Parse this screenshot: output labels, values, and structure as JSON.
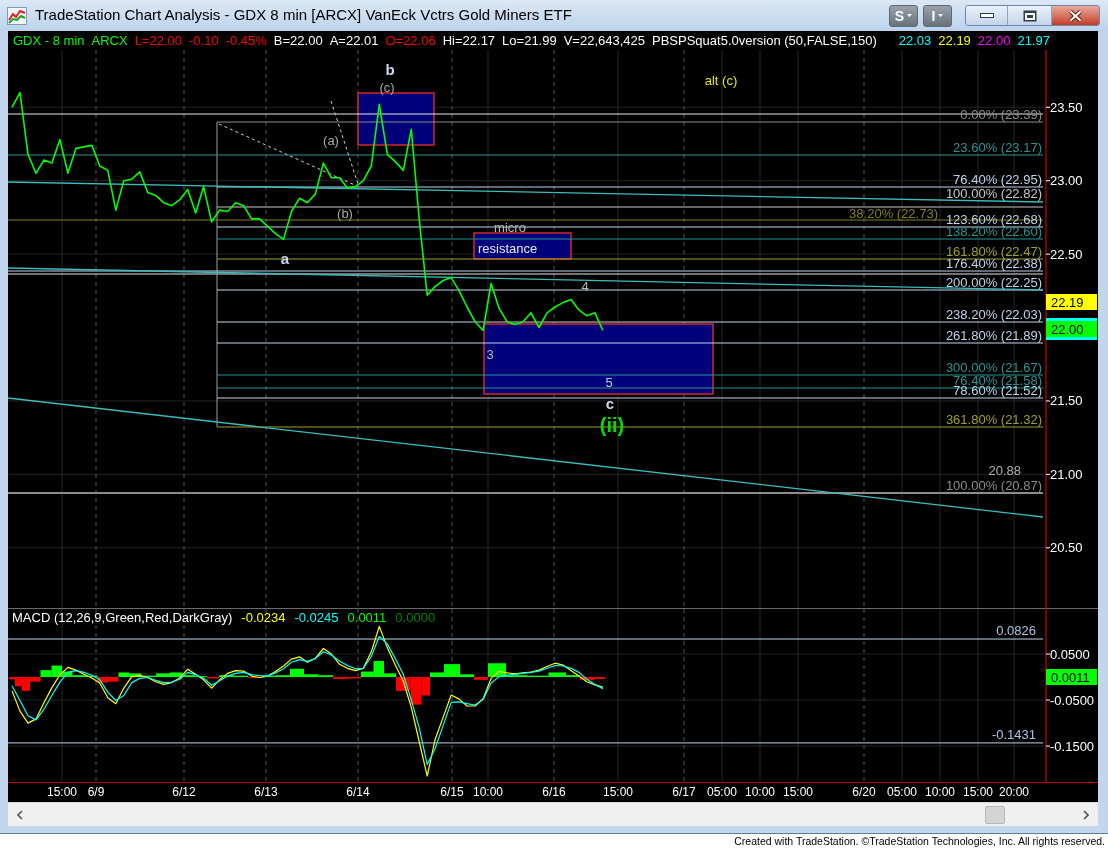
{
  "window": {
    "title": "TradeStation Chart Analysis - GDX 8 min [ARCX] VanEck Vctrs Gold Miners ETF",
    "tool_buttons": [
      {
        "label": "S"
      },
      {
        "label": "I"
      }
    ]
  },
  "quote_bar": {
    "items": [
      {
        "text": "GDX - 8 min",
        "color": "#00ff00"
      },
      {
        "text": "ARCX",
        "color": "#00ff00"
      },
      {
        "text": "L=22.00",
        "color": "#ff0000"
      },
      {
        "text": "-0.10",
        "color": "#ff0000"
      },
      {
        "text": "-0.45%",
        "color": "#ff0000"
      },
      {
        "text": "B=22.00",
        "color": "#ffffff"
      },
      {
        "text": "A=22.01",
        "color": "#ffffff"
      },
      {
        "text": "O=22.06",
        "color": "#ff0000"
      },
      {
        "text": "Hi=22.17",
        "color": "#ffffff"
      },
      {
        "text": "Lo=21.99",
        "color": "#ffffff"
      },
      {
        "text": "V=22,643,425",
        "color": "#ffffff"
      }
    ],
    "study": {
      "label": "PBSPSquat5.0version (50,FALSE,150)",
      "values": [
        {
          "text": "22.03",
          "color": "#00ffff"
        },
        {
          "text": "22.19",
          "color": "#ffff00"
        },
        {
          "text": "22.00",
          "color": "#ff00ff"
        },
        {
          "text": "21.97",
          "color": "#00ffff"
        }
      ]
    }
  },
  "price_chart": {
    "axis_labels": [
      "23.50",
      "23.00",
      "22.50",
      "21.50",
      "21.00",
      "20.50"
    ],
    "price_badges": [
      {
        "text": "22.19",
        "color": "#ffff00"
      },
      {
        "text": "22.00",
        "color": "#00ff00"
      }
    ],
    "fib_levels": [
      {
        "label": "0.00% (23.39)",
        "color": "#8c8c8c"
      },
      {
        "label": "23.60% (23.17)",
        "color": "#2a9494"
      },
      {
        "label": "76.40% (22.95)",
        "color": "#c0d4ec"
      },
      {
        "label": "100.00% (22.82)",
        "color": "#c8c8c8"
      },
      {
        "label": "38.20% (22.73)",
        "color": "#808020"
      },
      {
        "label": "123.60% (22.68)",
        "color": "#c0d4ec"
      },
      {
        "label": "138.20% (22.60)",
        "color": "#2a9494"
      },
      {
        "label": "161.80% (22.47)",
        "color": "#a0a028"
      },
      {
        "label": "176.40% (22.38)",
        "color": "#c0d4ec"
      },
      {
        "label": "200.00% (22.25)",
        "color": "#c0d4ec"
      },
      {
        "label": "238.20% (22.03)",
        "color": "#c0d4ec"
      },
      {
        "label": "261.80% (21.89)",
        "color": "#c0d4ec"
      },
      {
        "label": "300.00% (21.67)",
        "color": "#2a9494"
      },
      {
        "label": "76.40% (21.58)",
        "color": "#2a9494"
      },
      {
        "label": "78.60% (21.52)",
        "color": "#c0d4ec"
      },
      {
        "label": "361.80% (21.32)",
        "color": "#a0a028"
      },
      {
        "label": "100.00% (20.87)",
        "color": "#8c8c8c"
      }
    ],
    "price_marker": "20.88",
    "wave_labels": [
      {
        "text": "b",
        "kind": "major",
        "color": "#c8d8f0"
      },
      {
        "text": "(c)",
        "kind": "minor",
        "color": "#a8a8a8"
      },
      {
        "text": "alt (c)",
        "kind": "minor",
        "color": "#e8e800"
      },
      {
        "text": "(a)",
        "kind": "minor",
        "color": "#a8a8a8"
      },
      {
        "text": "(b)",
        "kind": "minor",
        "color": "#a8a8a8"
      },
      {
        "text": "a",
        "kind": "major",
        "color": "#c8d8f0"
      },
      {
        "text": "micro",
        "kind": "minor",
        "color": "#b8b8b8"
      },
      {
        "text": "4",
        "kind": "minor",
        "color": "#b8b8b8"
      },
      {
        "text": "3",
        "kind": "minor",
        "color": "#b8b8b8"
      },
      {
        "text": "5",
        "kind": "minor",
        "color": "#c0d0e8"
      },
      {
        "text": "c",
        "kind": "major",
        "color": "#c8d8f0"
      },
      {
        "text": "(ii)",
        "kind": "degree",
        "color": "#00e000"
      }
    ],
    "zone_label": "resistance"
  },
  "macd_panel": {
    "legend": {
      "label": "MACD (12,26,9,Green,Red,DarkGray)",
      "values": [
        {
          "text": "-0.0234",
          "color": "#ffff00"
        },
        {
          "text": "-0.0245",
          "color": "#00ffff"
        },
        {
          "text": "0.0011",
          "color": "#00ff00"
        },
        {
          "text": "0.0000",
          "color": "#008000"
        }
      ]
    },
    "axis_labels": [
      "0.0500",
      "-0.0500",
      "-0.1500"
    ],
    "level_labels": [
      "0.0826",
      "-0.1431"
    ],
    "value_badge": {
      "text": "0.0011",
      "color": "#00ff00"
    }
  },
  "time_axis": {
    "labels": [
      "15:00",
      "6/9",
      "6/12",
      "6/13",
      "6/14",
      "6/15",
      "10:00",
      "6/16",
      "15:00",
      "6/17",
      "05:00",
      "10:00",
      "15:00",
      "6/20",
      "05:00",
      "10:00",
      "15:00",
      "20:00"
    ]
  },
  "footer": "Created with TradeStation. ©TradeStation Technologies, Inc. All rights reserved."
}
